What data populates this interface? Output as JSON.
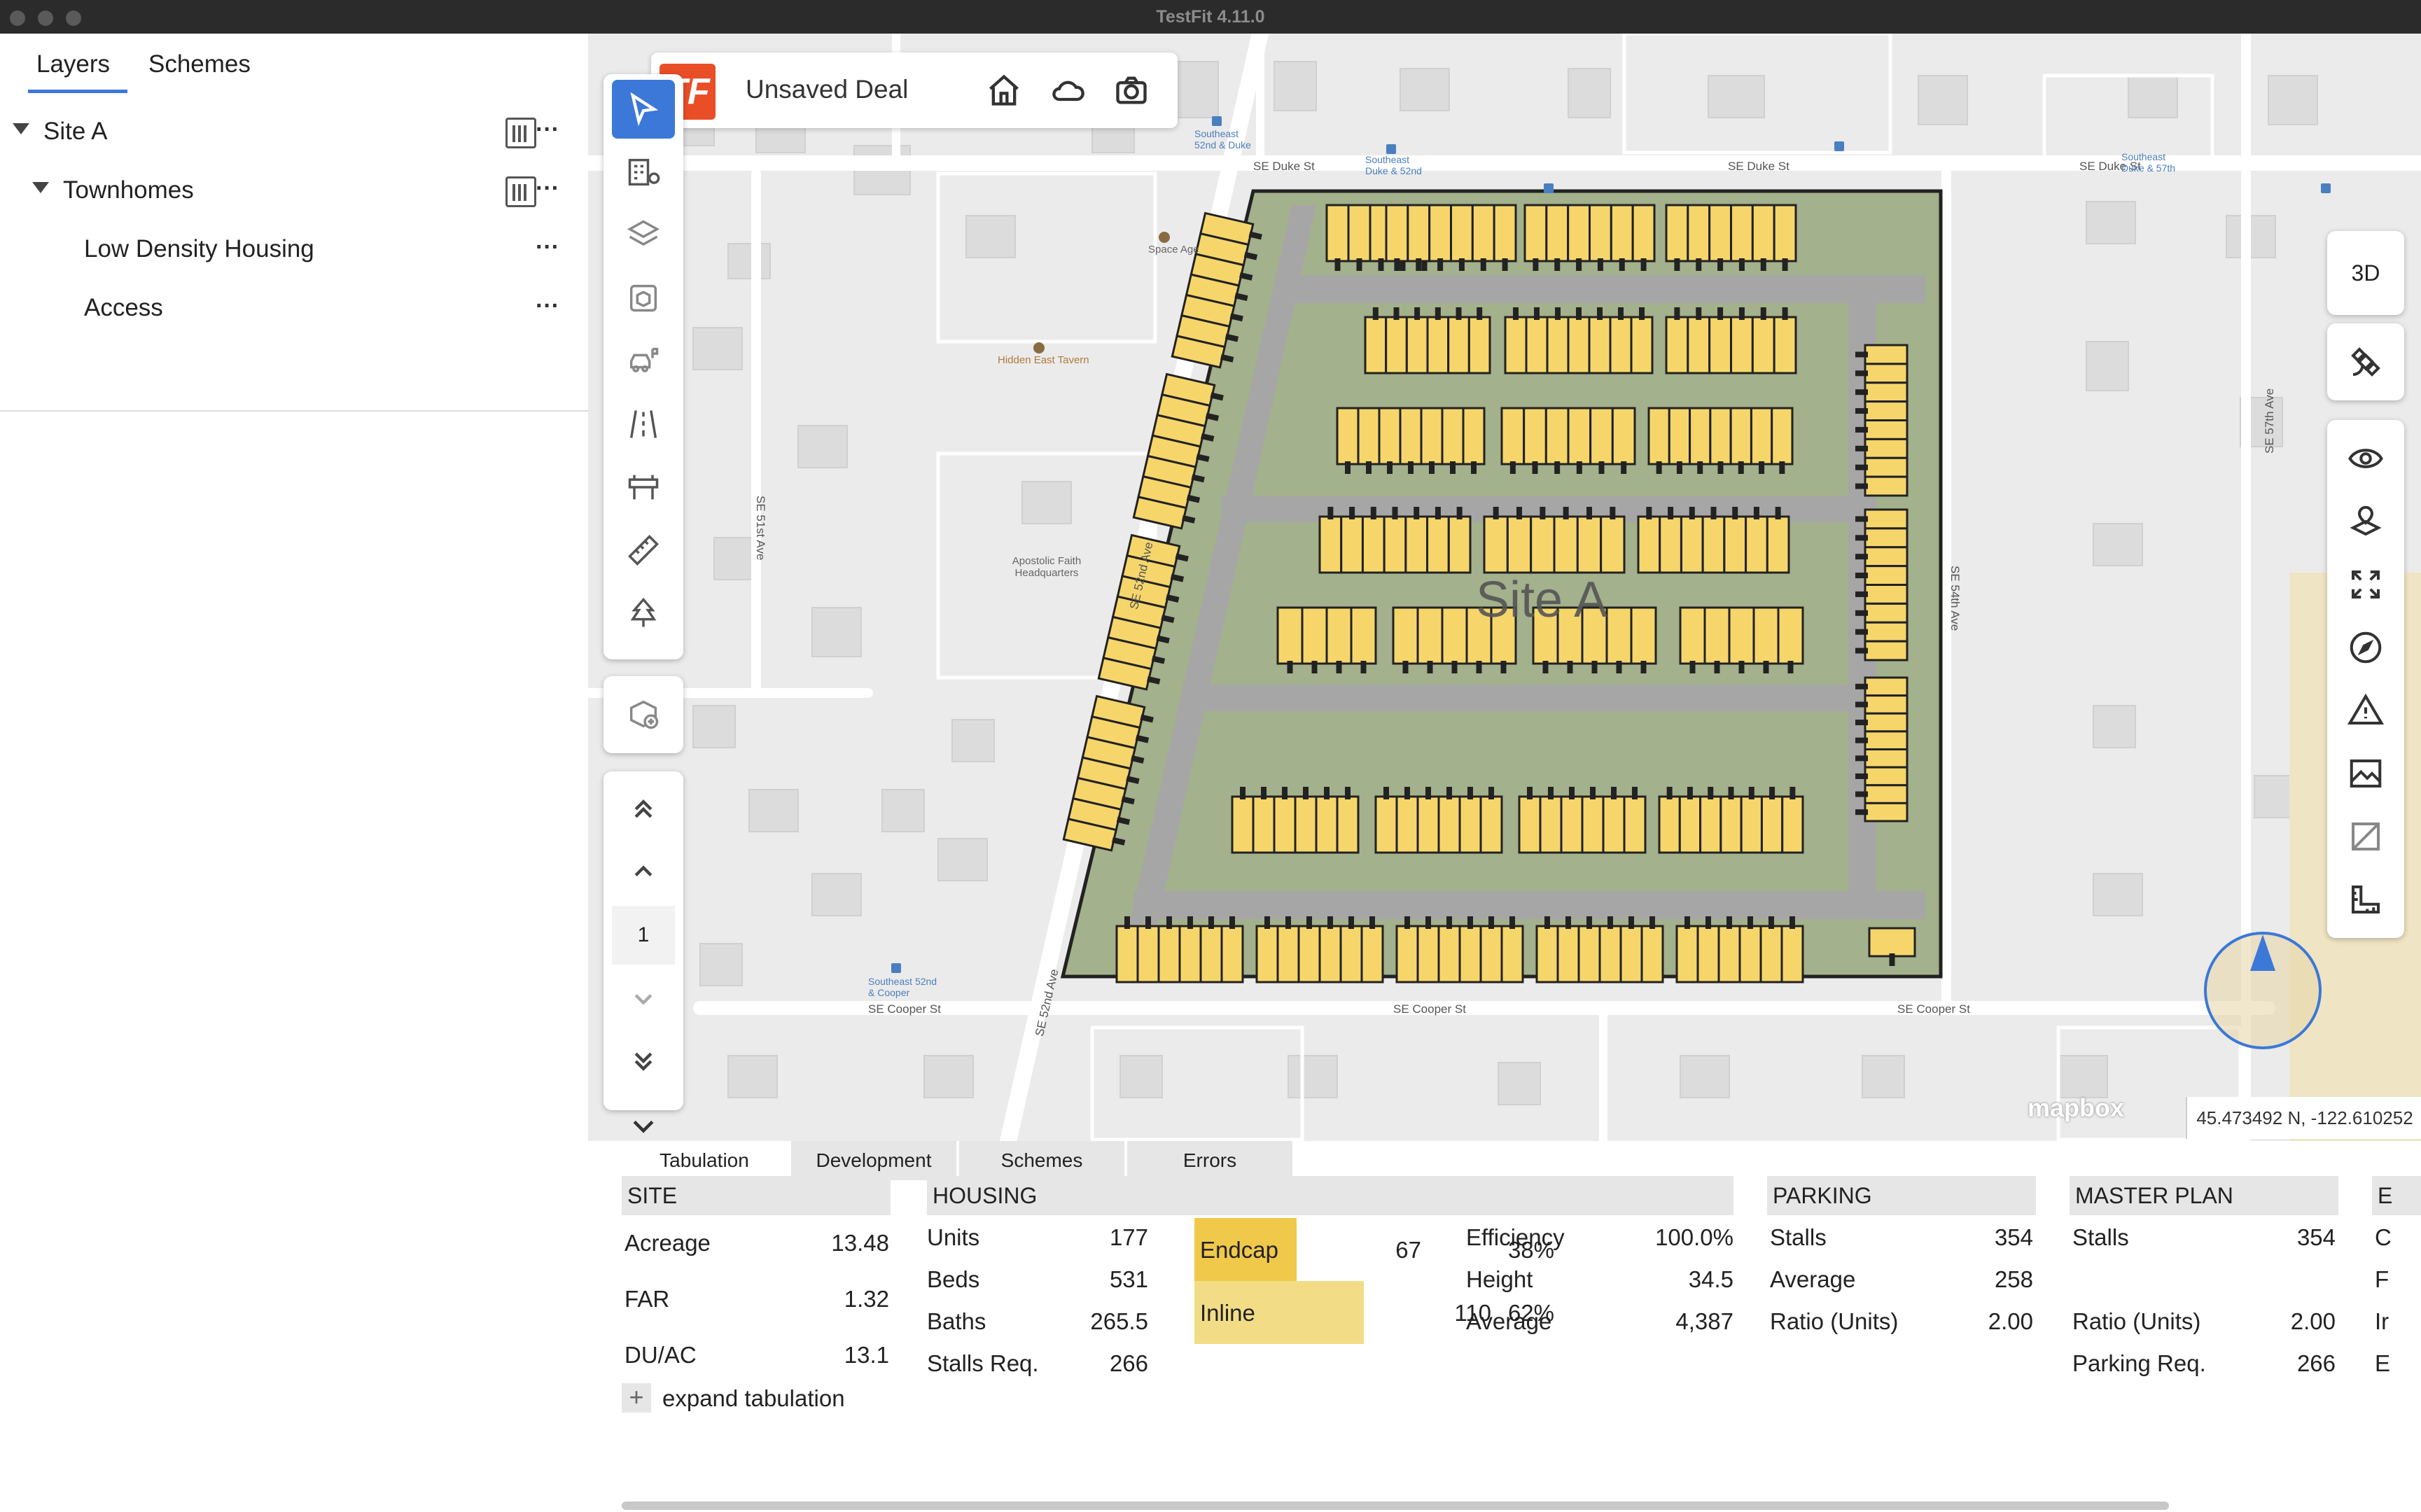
{
  "window": {
    "title": "TestFit 4.11.0"
  },
  "left_panel": {
    "tabs": [
      "Layers",
      "Schemes"
    ],
    "tree": [
      {
        "label": "Site A",
        "level": 0
      },
      {
        "label": "Townhomes",
        "level": 1
      },
      {
        "label": "Low Density Housing",
        "level": 2
      },
      {
        "label": "Access",
        "level": 2
      }
    ]
  },
  "deal": {
    "title": "Unsaved Deal",
    "logo_text": "TF"
  },
  "map": {
    "site_label": "Site A",
    "right_toolbar_3d": "3D",
    "floor_number": "1",
    "coordinates": "45.473492 N, -122.610252 W",
    "attribution": "mapbox",
    "street_labels": {
      "duke": "SE Duke St",
      "cooper": "SE Cooper St",
      "ave51": "SE 51st Ave",
      "ave52": "SE 52nd Ave",
      "ave54": "SE 54th Ave",
      "ave57": "SE 57th Ave"
    },
    "poi": {
      "tavern": "Hidden East Tavern",
      "church": "Apostolic Faith Headquarters",
      "space": "Space Age",
      "stop1": "Southeast 52nd & Duke",
      "stop2": "Southeast Duke & 52nd",
      "stop3": "Southeast Duke & 57th",
      "stop4": "Southeast 52nd & Cooper"
    }
  },
  "bottom_tabs": [
    "Tabulation",
    "Development",
    "Schemes",
    "Errors"
  ],
  "tabulation": {
    "site": {
      "header": "SITE",
      "rows": [
        {
          "label": "Acreage",
          "value": "13.48"
        },
        {
          "label": "FAR",
          "value": "1.32"
        },
        {
          "label": "DU/AC",
          "value": "13.1"
        }
      ],
      "expand_label": "expand tabulation"
    },
    "housing": {
      "header": "HOUSING",
      "rows": [
        {
          "label": "Units",
          "value": "177"
        },
        {
          "label": "Beds",
          "value": "531"
        },
        {
          "label": "Baths",
          "value": "265.5"
        },
        {
          "label": "Stalls Req.",
          "value": "266"
        }
      ],
      "types": [
        {
          "label": "Endcap",
          "count": "67",
          "pct": "38%",
          "color": "#f0c84a"
        },
        {
          "label": "Inline",
          "count": "110",
          "pct": "62%",
          "color": "#f2dd86"
        }
      ],
      "stats": [
        {
          "label": "Efficiency",
          "value": "100.0%"
        },
        {
          "label": "Height",
          "value": "34.5"
        },
        {
          "label": "Average",
          "value": "4,387"
        }
      ]
    },
    "parking": {
      "header": "PARKING",
      "rows": [
        {
          "label": "Stalls",
          "value": "354"
        },
        {
          "label": "Average",
          "value": "258"
        },
        {
          "label": "Ratio (Units)",
          "value": "2.00"
        }
      ]
    },
    "master_plan": {
      "header": "MASTER PLAN",
      "rows": [
        {
          "label": "Stalls",
          "value": "354"
        },
        {
          "label": "Ratio (Units)",
          "value": "2.00"
        },
        {
          "label": "Parking Req.",
          "value": "266"
        }
      ]
    },
    "cut_column": {
      "header": "E",
      "letters": [
        "C",
        "F",
        "Ir",
        "E"
      ]
    }
  },
  "colors": {
    "accent": "#3b78d8",
    "brand": "#e94e27",
    "unit_fill": "#f6d66b",
    "site_green": "#a3b18c",
    "road": "#a6a6a6"
  }
}
